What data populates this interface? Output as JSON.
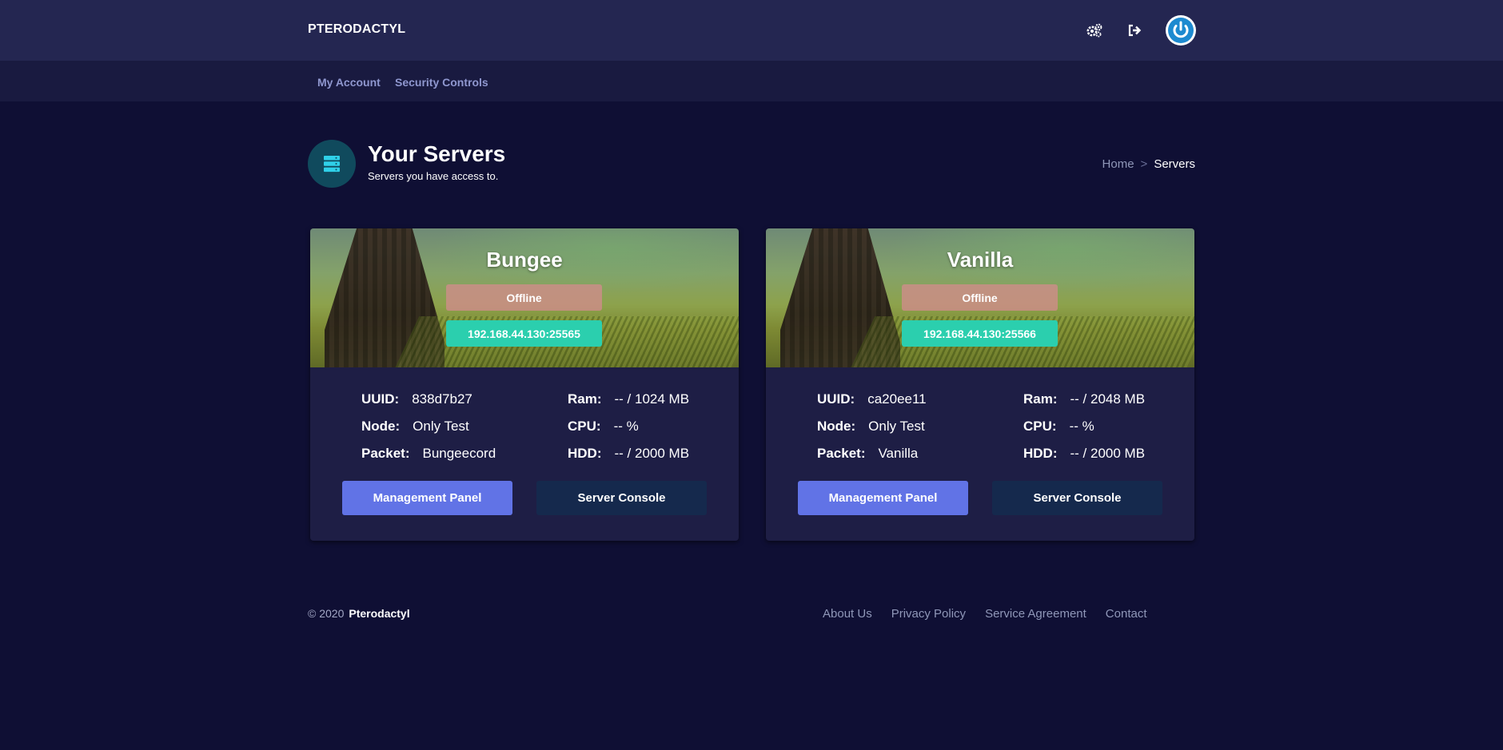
{
  "brand": "PTERODACTYL",
  "topbar": {
    "icons": [
      "cogs-icon",
      "sign-out-icon",
      "power-icon"
    ]
  },
  "subnav": {
    "items": [
      {
        "label": "My Account"
      },
      {
        "label": "Security Controls"
      }
    ]
  },
  "page": {
    "title": "Your Servers",
    "subtitle": "Servers you have access to.",
    "icon": "server-stack-icon"
  },
  "breadcrumb": {
    "home": "Home",
    "separator": ">",
    "current": "Servers"
  },
  "servers": [
    {
      "name": "Bungee",
      "status": "Offline",
      "address": "192.168.44.130:25565",
      "uuid_label": "UUID:",
      "uuid": "838d7b27",
      "node_label": "Node:",
      "node": "Only Test",
      "packet_label": "Packet:",
      "packet": "Bungeecord",
      "ram_label": "Ram:",
      "ram": "-- / 1024 MB",
      "cpu_label": "CPU:",
      "cpu": "-- %",
      "hdd_label": "HDD:",
      "hdd": "-- / 2000 MB",
      "manage_label": "Management Panel",
      "console_label": "Server Console"
    },
    {
      "name": "Vanilla",
      "status": "Offline",
      "address": "192.168.44.130:25566",
      "uuid_label": "UUID:",
      "uuid": "ca20ee11",
      "node_label": "Node:",
      "node": "Only Test",
      "packet_label": "Packet:",
      "packet": "Vanilla",
      "ram_label": "Ram:",
      "ram": "-- / 2048 MB",
      "cpu_label": "CPU:",
      "cpu": "-- %",
      "hdd_label": "HDD:",
      "hdd": "-- / 2000 MB",
      "manage_label": "Management Panel",
      "console_label": "Server Console"
    }
  ],
  "footer": {
    "copyright": "© 2020",
    "brand": "Pterodactyl",
    "links": [
      "About Us",
      "Privacy Policy",
      "Service Agreement",
      "Contact"
    ]
  },
  "colors": {
    "background": "#0f0f34",
    "topbar": "#242651",
    "subnav": "#191a40",
    "card": "#1e1e45",
    "primary_button": "#6173e6",
    "secondary_button": "#15294d",
    "ip_badge": "#2bcfae",
    "status_offline": "#d18c8c",
    "header_icon_bg": "#104a5d",
    "header_icon": "#2fd0e8"
  }
}
